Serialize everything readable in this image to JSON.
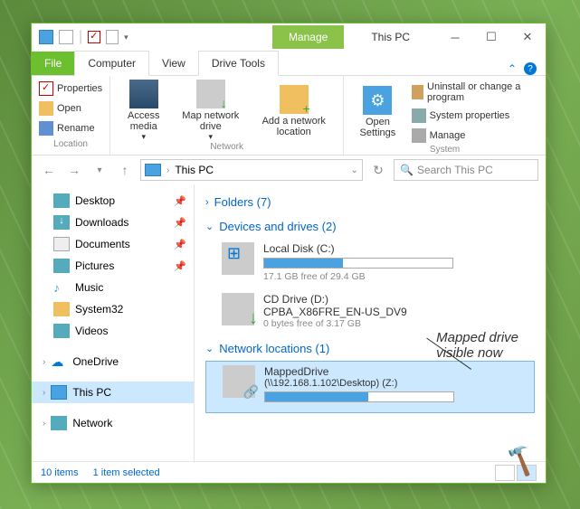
{
  "window": {
    "title": "This PC",
    "manage_tab": "Manage"
  },
  "tabs": {
    "file": "File",
    "computer": "Computer",
    "view": "View",
    "drivetools": "Drive Tools"
  },
  "ribbon": {
    "properties": "Properties",
    "open": "Open",
    "rename": "Rename",
    "location_label": "Location",
    "access_media": "Access media",
    "map_drive": "Map network drive",
    "add_location": "Add a network location",
    "network_label": "Network",
    "open_settings": "Open Settings",
    "uninstall": "Uninstall or change a program",
    "sys_props": "System properties",
    "manage": "Manage",
    "system_label": "System"
  },
  "address": {
    "path": "This PC",
    "search_placeholder": "Search This PC"
  },
  "sidebar": {
    "items": [
      {
        "label": "Desktop",
        "pinned": true
      },
      {
        "label": "Downloads",
        "pinned": true
      },
      {
        "label": "Documents",
        "pinned": true
      },
      {
        "label": "Pictures",
        "pinned": true
      },
      {
        "label": "Music",
        "pinned": false
      },
      {
        "label": "System32",
        "pinned": false
      },
      {
        "label": "Videos",
        "pinned": false
      }
    ],
    "onedrive": "OneDrive",
    "thispc": "This PC",
    "network": "Network"
  },
  "sections": {
    "folders": "Folders (7)",
    "devices": "Devices and drives (2)",
    "netloc": "Network locations (1)"
  },
  "drives": {
    "c": {
      "name": "Local Disk (C:)",
      "stat": "17.1 GB free of 29.4 GB",
      "fill_pct": 42
    },
    "d": {
      "name": "CD Drive (D:)",
      "sub": "CPBA_X86FRE_EN-US_DV9",
      "stat": "0 bytes free of 3.17 GB"
    },
    "mapped": {
      "name": "MappedDrive",
      "path": "(\\\\192.168.1.102\\Desktop) (Z:)",
      "fill_pct": 55
    }
  },
  "status": {
    "items": "10 items",
    "selected": "1 item selected"
  },
  "annotation": {
    "line1": "Mapped drive",
    "line2": "visible now"
  }
}
